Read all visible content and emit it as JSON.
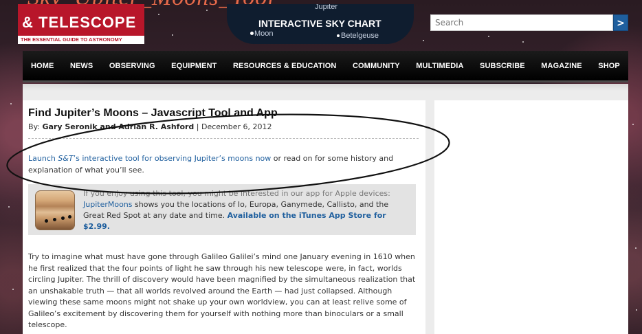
{
  "header": {
    "top_title": "Sky_Upiter_Moons_Tool",
    "logo": {
      "brand": "& TELESCOPE",
      "tagline": "THE ESSENTIAL GUIDE TO ASTRONOMY"
    },
    "chart_banner": {
      "title": "INTERACTIVE SKY CHART",
      "labels": {
        "jupiter": "Jupiter",
        "moon": "Moon",
        "betelgeuse": "Betelgeuse"
      }
    },
    "search": {
      "placeholder": "Search",
      "button": ">"
    }
  },
  "nav": {
    "items": [
      "HOME",
      "NEWS",
      "OBSERVING",
      "EQUIPMENT",
      "RESOURCES & EDUCATION",
      "COMMUNITY",
      "MULTIMEDIA",
      "SUBSCRIBE",
      "MAGAZINE",
      "SHOP"
    ]
  },
  "article": {
    "title": "Find Jupiter’s Moons – Javascript Tool and App",
    "by_prefix": "By: ",
    "authors": "Gary Seronik and Adrian R. Ashford",
    "date_sep": " | ",
    "date": "December 6, 2012",
    "lead": {
      "link_1": "Launch ",
      "link_em": "S&T",
      "link_2": "’s interactive tool for observing Jupiter’s moons now",
      "rest": " or read on for some history and explanation of what you’ll see."
    },
    "promo": {
      "faded": "If you enjoy using this tool, you might be interested in our app for Apple devices: ",
      "app_link": "JupiterMoons",
      "desc": " shows you the locations of Io, Europa, Ganymede, Callisto, and the Great Red Spot at any date and time. ",
      "store": "Available on the iTunes App Store for $2.99."
    },
    "body": "Try to imagine what must have gone through Galileo Galilei’s mind one January evening in 1610 when he first realized that the four points of light he saw through his new telescope were, in fact, worlds circling Jupiter. The thrill of discovery would have been magnified by the simultaneous realization that an unshakable truth — that all worlds revolved around the Earth — had just collapsed. Although viewing these same moons might not shake up your own worldview, you can at least relive some of Galileo’s excitement by discovering them for yourself with nothing more than binoculars or a small telescope."
  },
  "colors": {
    "brand_red": "#b8162a",
    "link_blue": "#1f5f9e",
    "nav_bg": "#000000"
  }
}
